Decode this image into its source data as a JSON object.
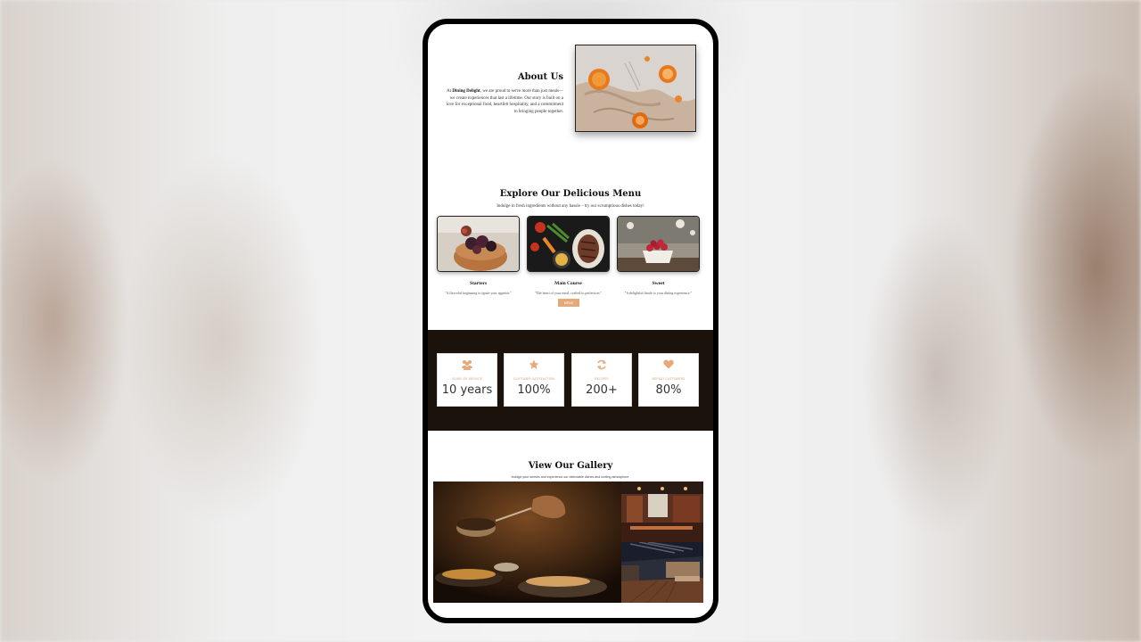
{
  "about": {
    "title": "About Us",
    "text_prefix": "At ",
    "brand": "Dining Delight",
    "text_body": ", we are proud to serve more than just meals—we create experiences that last a lifetime. Our story is built on a love for exceptional food, heartfelt hospitality, and a commitment to bringing people together."
  },
  "menu": {
    "title": "Explore Our Delicious Menu",
    "subtitle": "Indulge in fresh ingredients without any hassle – try our scrumptious dishes today!",
    "button_label": "menu",
    "cards": [
      {
        "name": "Starters",
        "desc": "\"A flavorful beginning to ignite your appetite.\""
      },
      {
        "name": "Main Course",
        "desc": "\"The heart of your meal, crafted to perfection.\""
      },
      {
        "name": "Sweet",
        "desc": "\"A delightful finale to your dining experience.\""
      }
    ]
  },
  "stats": [
    {
      "icon": "users-icon",
      "label": "Years of service",
      "value": "10 years"
    },
    {
      "icon": "star-icon",
      "label": "Customer satisfaction",
      "value": "100%"
    },
    {
      "icon": "refresh-icon",
      "label": "Recipes",
      "value": "200+"
    },
    {
      "icon": "heart-icon",
      "label": "Repeat customers",
      "value": "80%"
    }
  ],
  "gallery": {
    "title": "View Our Gallery",
    "subtitle": "Indulge your senses and experience our delectable dishes and inviting atmosphere."
  },
  "colors": {
    "accent": "#e6a97a",
    "stats_bg": "#1b120c",
    "phone_frame": "#000000"
  }
}
